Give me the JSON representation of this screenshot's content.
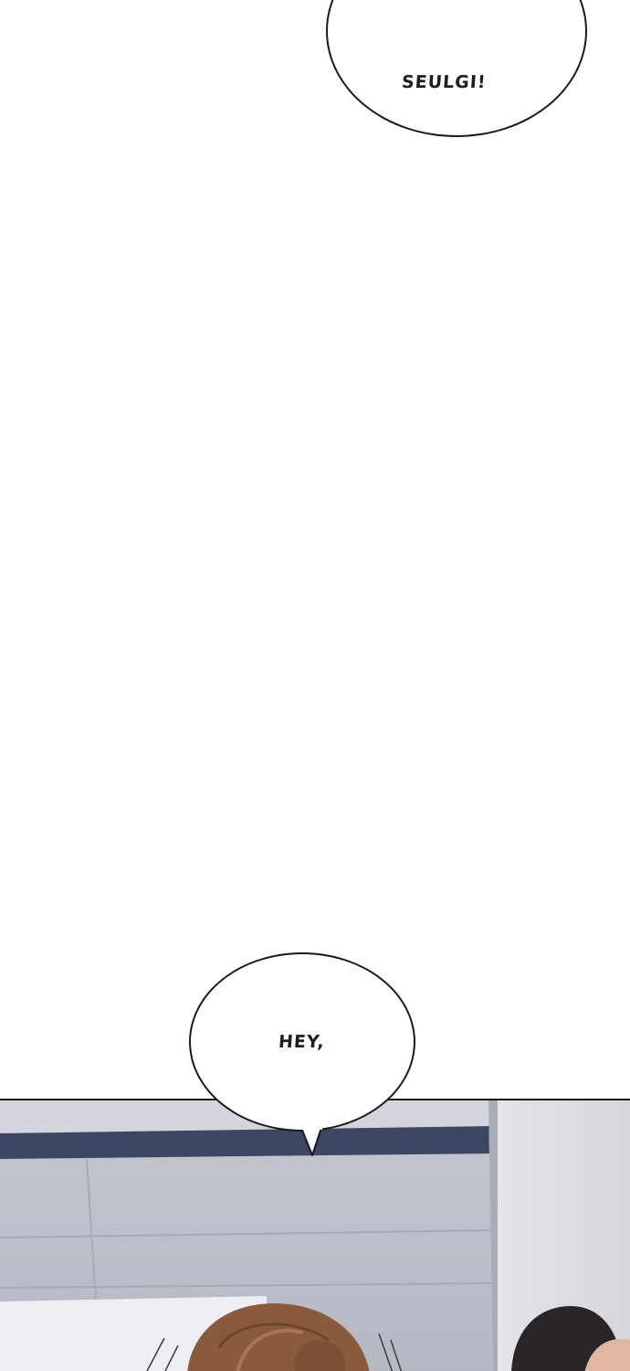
{
  "comic": {
    "bubbles": [
      {
        "text": "SEULGI!"
      },
      {
        "text": "HEY,"
      }
    ]
  },
  "colors": {
    "background": "#ffffff",
    "bubble_outline": "#1a1a1a",
    "wall": "#c9ccd6",
    "ceiling_band": "#3e4762",
    "hair_brown": "#8a5a3c",
    "hair_dark": "#2a2628"
  }
}
